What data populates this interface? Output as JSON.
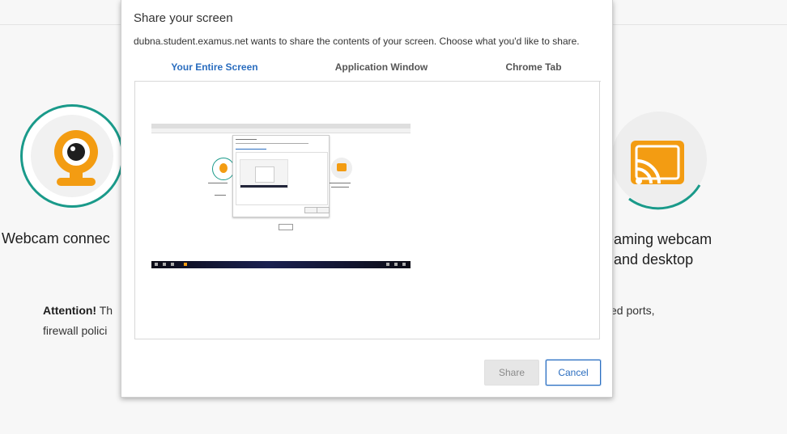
{
  "background": {
    "step1": {
      "title": "Webcam connec"
    },
    "step3": {
      "title_line1": "eaming webcam",
      "title_line2": "and desktop"
    },
    "attention": {
      "label": "Attention!",
      "text": " Th",
      "line2": "firewall polici",
      "right_fragment": "cked ports,"
    },
    "colors": {
      "accent_teal": "#1a9a8a",
      "icon_orange": "#f39c12"
    },
    "icons": [
      "webcam-icon",
      "cast-screen-icon"
    ]
  },
  "dialog": {
    "title": "Share your screen",
    "description": "dubna.student.examus.net wants to share the contents of your screen. Choose what you'd like to share.",
    "tabs": [
      {
        "label": "Your Entire Screen",
        "active": true
      },
      {
        "label": "Application Window",
        "active": false
      },
      {
        "label": "Chrome Tab",
        "active": false
      }
    ],
    "share_label": "Share",
    "cancel_label": "Cancel",
    "colors": {
      "accent_blue": "#2a6dbf"
    }
  }
}
